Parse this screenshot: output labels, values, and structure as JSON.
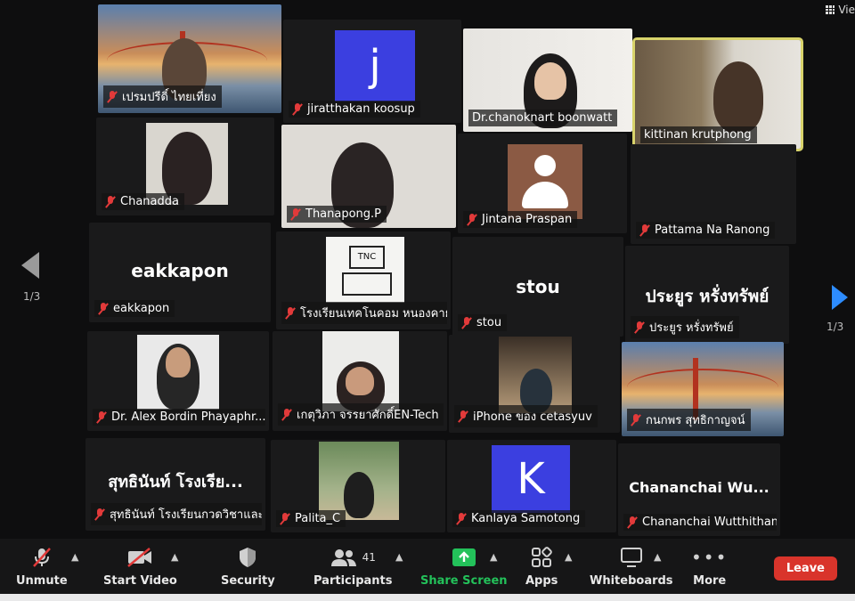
{
  "view_label": "Vie",
  "pagination": {
    "left": "1/3",
    "right": "1/3"
  },
  "tiles": [
    {
      "id": "t1",
      "name": "เปรมปรีดิ์ ไทยเที่ยง"
    },
    {
      "id": "t2",
      "name": "jiratthakan koosup",
      "letter": "j"
    },
    {
      "id": "t3",
      "name": "Dr.chanoknart boonwatt"
    },
    {
      "id": "t4",
      "name": "kittinan krutphong"
    },
    {
      "id": "t5",
      "name": "Chanadda"
    },
    {
      "id": "t6",
      "name": "Thanapong.P"
    },
    {
      "id": "t7",
      "name": "Jintana Praspan"
    },
    {
      "id": "t8",
      "name": "Pattama Na Ranong"
    },
    {
      "id": "t9",
      "name": "eakkapon",
      "big": "eakkapon"
    },
    {
      "id": "t10",
      "name": "โรงเรียนเทคโนคอม หนองคาย",
      "logo": "TNC"
    },
    {
      "id": "t11",
      "name": "stou",
      "big": "stou"
    },
    {
      "id": "t12",
      "name": "ประยูร หรั่งทรัพย์",
      "big": "ประยูร หรั่งทรัพย์"
    },
    {
      "id": "t13",
      "name": "Dr. Alex Bordin Phayaphr..."
    },
    {
      "id": "t14",
      "name": "เกตุวิภา จรรยาศักดิ์EN-Tech"
    },
    {
      "id": "t15",
      "name": "iPhone ของ cetasyuv"
    },
    {
      "id": "t16",
      "name": "กนกพร สุทธิกาญจน์"
    },
    {
      "id": "t17",
      "name": "สุทธินันท์ โรงเรียนกวดวิชาและ...",
      "big": "สุทธินันท์ โรงเรีย..."
    },
    {
      "id": "t18",
      "name": "Palita_C"
    },
    {
      "id": "t19",
      "name": "Kanlaya Samotong",
      "letter": "K"
    },
    {
      "id": "t20",
      "name": "Chananchai Wutthithany...",
      "big": "Chananchai  Wu..."
    }
  ],
  "toolbar": {
    "unmute": "Unmute",
    "start_video": "Start Video",
    "security": "Security",
    "participants": "Participants",
    "participants_count": "41",
    "share_screen": "Share Screen",
    "apps": "Apps",
    "whiteboards": "Whiteboards",
    "more": "More",
    "leave": "Leave"
  },
  "colors": {
    "mic_muted": "#e23a3a",
    "share_green": "#23c15a",
    "leave_red": "#d9342b",
    "active_speaker": "#d8d36b",
    "letter_tile_blue": "#3b3fe0"
  }
}
